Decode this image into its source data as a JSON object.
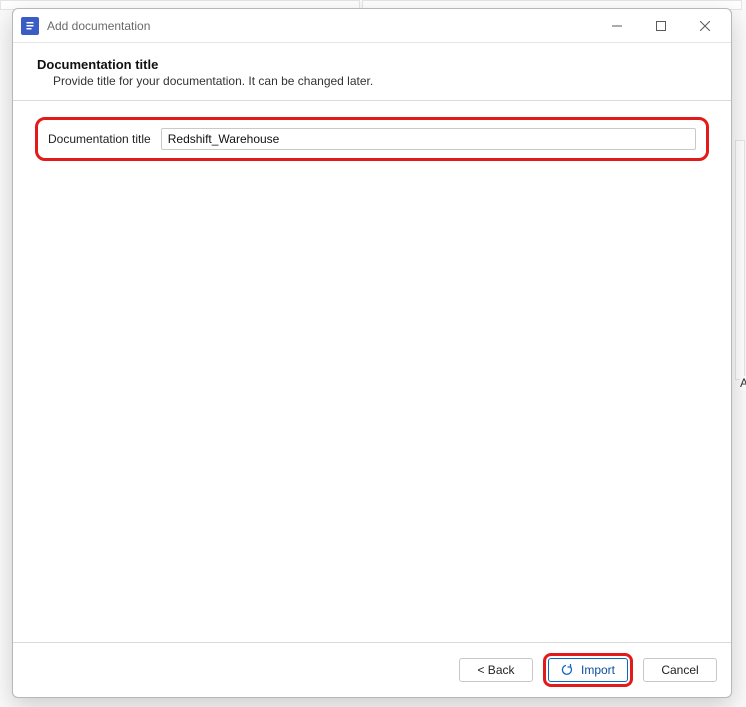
{
  "window": {
    "title": "Add documentation"
  },
  "header": {
    "title": "Documentation title",
    "subtitle": "Provide title for your documentation. It can be changed later."
  },
  "form": {
    "title_label": "Documentation title",
    "title_value": "Redshift_Warehouse"
  },
  "buttons": {
    "back": "< Back",
    "import": "Import",
    "cancel": "Cancel"
  },
  "backdrop": {
    "edge_char": "A"
  }
}
